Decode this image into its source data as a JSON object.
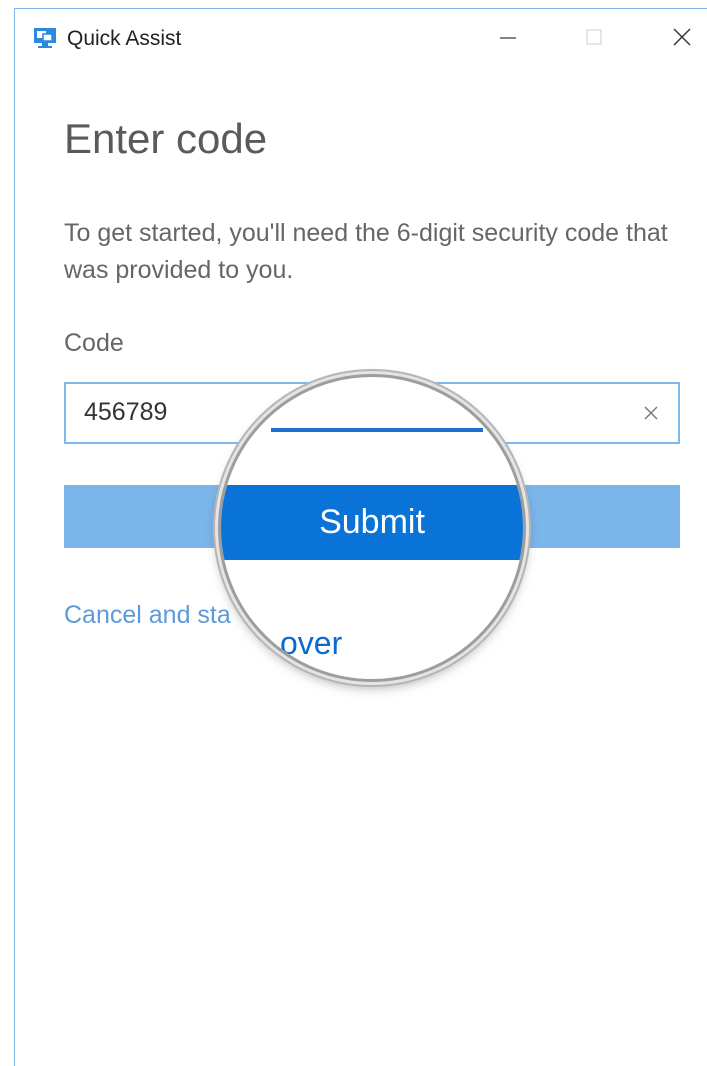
{
  "window": {
    "title": "Quick Assist",
    "icon": "quick-assist-monitor-icon",
    "controls": [
      "minimize-icon",
      "maximize-icon",
      "close-icon"
    ]
  },
  "main": {
    "heading": "Enter code",
    "description": "To get started, you'll need the 6-digit security code that was provided to you.",
    "code_label": "Code",
    "code_value": "456789",
    "clear_icon": "clear-x-icon",
    "submit_label": "Submit",
    "cancel_link_visible": "Cancel and sta",
    "cancel_link_tail": "over"
  },
  "colors": {
    "accent": "#0a73d8",
    "button_inactive": "#7cb5ea",
    "link": "#5c9ad9",
    "input_border": "#7db9ee"
  }
}
